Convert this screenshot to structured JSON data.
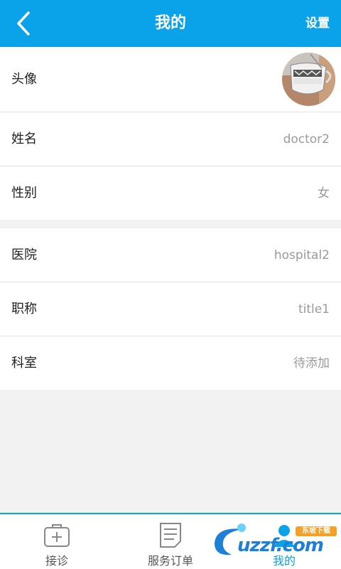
{
  "header": {
    "title": "我的",
    "settings_label": "设置"
  },
  "profile": {
    "avatar_label": "头像",
    "rows": [
      {
        "label": "姓名",
        "value": "doctor2"
      },
      {
        "label": "性别",
        "value": "女"
      }
    ]
  },
  "work": {
    "rows": [
      {
        "label": "医院",
        "value": "hospital2"
      },
      {
        "label": "职称",
        "value": "title1"
      },
      {
        "label": "科室",
        "value": "待添加"
      }
    ]
  },
  "tabs": [
    {
      "label": "接诊",
      "icon": "medical-kit-icon"
    },
    {
      "label": "服务订单",
      "icon": "document-icon"
    },
    {
      "label": "我的",
      "icon": "person-icon",
      "active": true
    }
  ],
  "watermark": {
    "text": "uzzf.com",
    "subtext": "东坡下载"
  },
  "colors": {
    "accent": "#0aa2e8",
    "background": "#f2f2f2"
  }
}
